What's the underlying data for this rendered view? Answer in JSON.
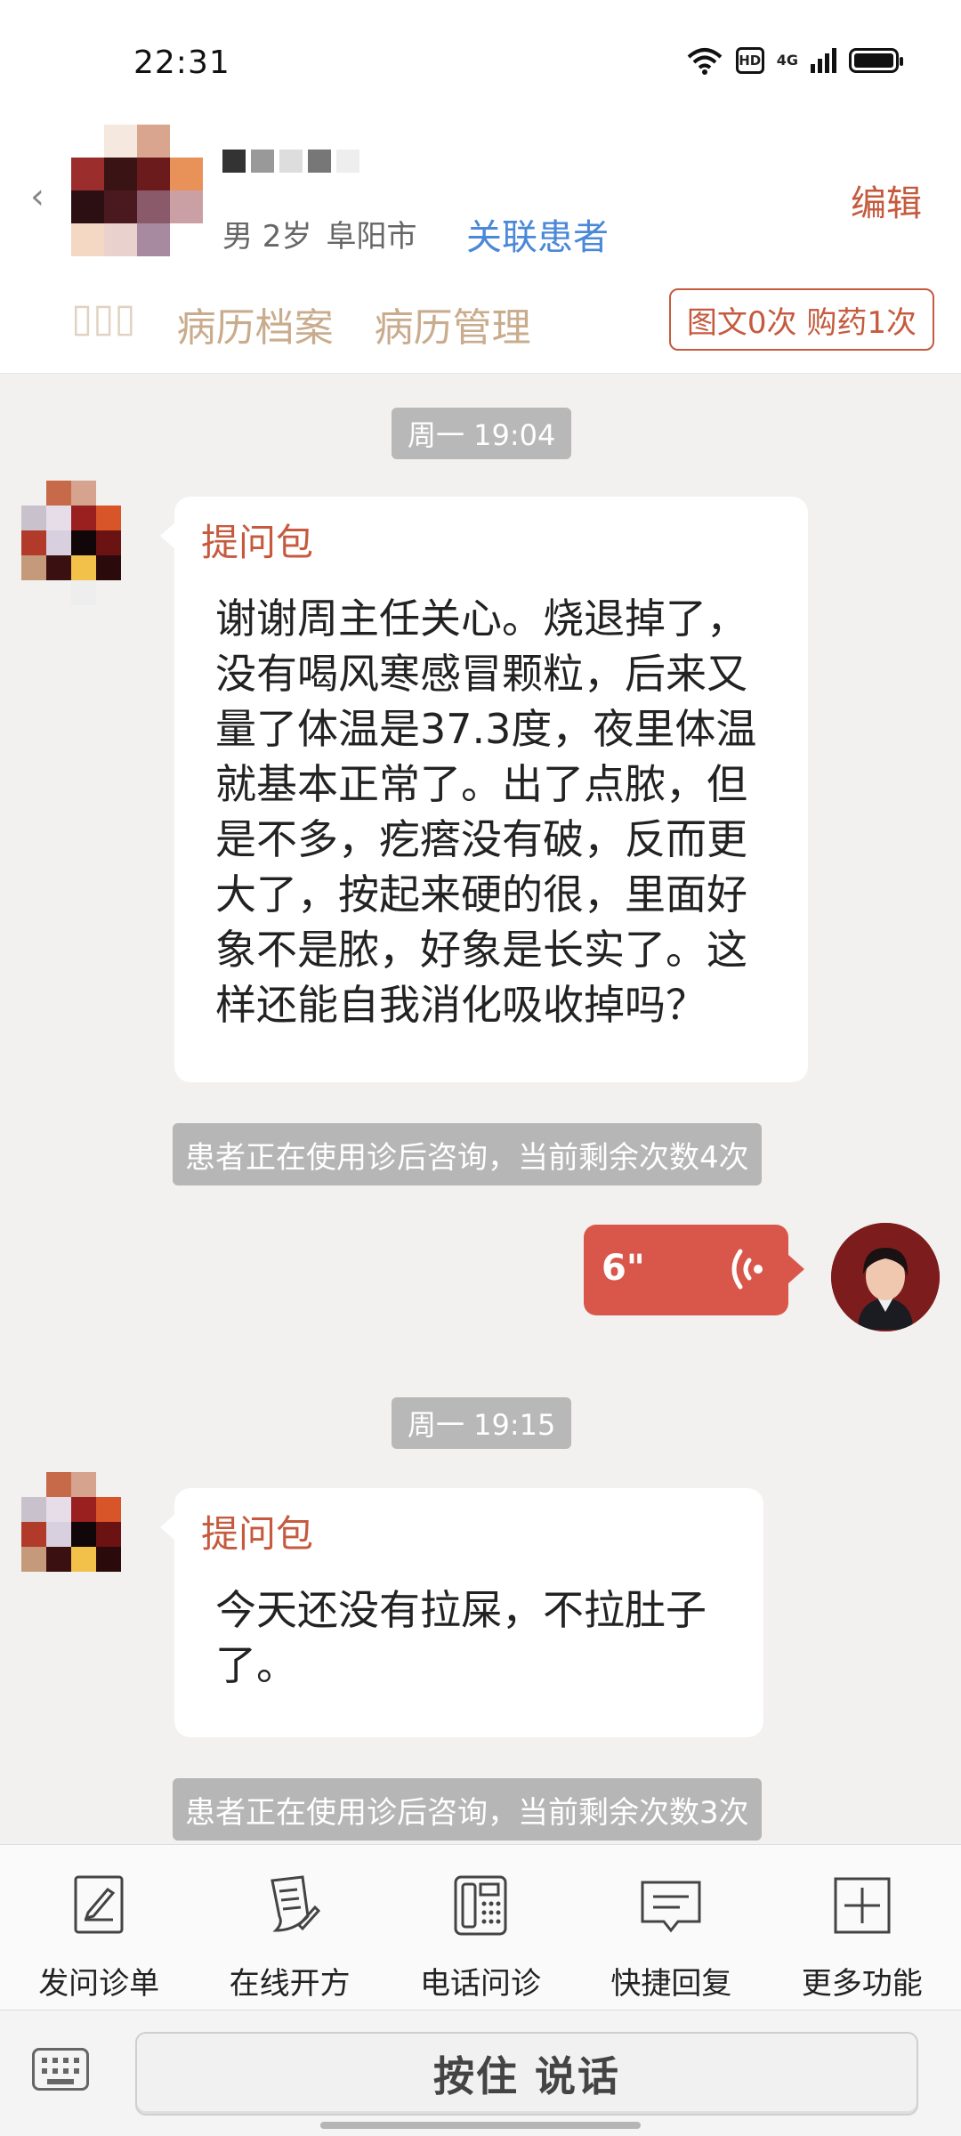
{
  "status_bar": {
    "time": "22:31",
    "hd": "HD",
    "network": "4G"
  },
  "header": {
    "patient_meta": [
      "男 2岁",
      "阜阳市"
    ],
    "link_patient": "关联患者",
    "edit": "编辑",
    "tabs": [
      "病历档案",
      "病历管理"
    ],
    "usage": "图文0次 购药1次",
    "icons": {
      "back": "back-arrow-icon"
    }
  },
  "chat": {
    "time_1": "周一 19:04",
    "msg_1": {
      "title": "提问包",
      "lines": [
        "谢谢周主任关心。烧退掉了，",
        "没有喝风寒感冒颗粒，后来又",
        "量了体温是37.3度，夜里体温",
        "就基本正常了。出了点脓，但",
        "是不多，疙瘩没有破，反而更",
        "大了，按起来硬的很，里面好",
        "象不是脓，好象是长实了。这",
        "样还能自我消化吸收掉吗？"
      ]
    },
    "notice_1": "患者正在使用诊后咨询，当前剩余次数4次",
    "voice": {
      "duration": "6\""
    },
    "time_2": "周一 19:15",
    "msg_2": {
      "title": "提问包",
      "lines": [
        "今天还没有拉屎，不拉肚子",
        "了。"
      ]
    },
    "notice_2": "患者正在使用诊后咨询，当前剩余次数3次"
  },
  "toolbar": {
    "items": [
      {
        "label": "发问诊单",
        "icon": "form-icon"
      },
      {
        "label": "在线开方",
        "icon": "prescription-icon"
      },
      {
        "label": "电话问诊",
        "icon": "phone-icon"
      },
      {
        "label": "快捷回复",
        "icon": "quick-reply-icon"
      },
      {
        "label": "更多功能",
        "icon": "plus-icon"
      }
    ]
  },
  "input_bar": {
    "hold_to_talk": "按住 说话",
    "keyboard_icon": "keyboard-icon"
  },
  "colors": {
    "accent": "#c55a3e",
    "link": "#4a88d8",
    "voice": "#d9574a"
  }
}
